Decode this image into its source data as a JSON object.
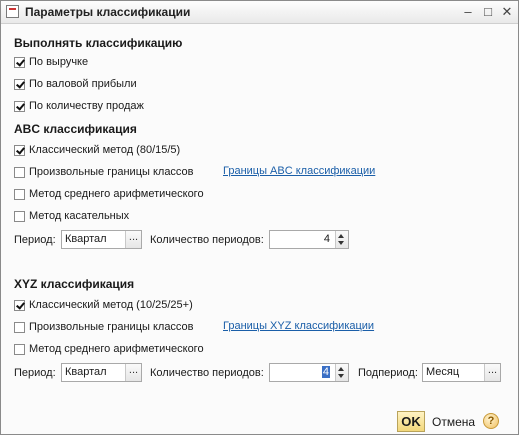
{
  "window": {
    "title": "Параметры классификации"
  },
  "classification": {
    "heading": "Выполнять классификацию",
    "options": [
      {
        "label": "По выручке",
        "checked": true
      },
      {
        "label": "По валовой прибыли",
        "checked": true
      },
      {
        "label": "По количеству продаж",
        "checked": true
      }
    ]
  },
  "abc": {
    "heading": "ABC классификация",
    "classic": {
      "label": "Классический метод (80/15/5)",
      "checked": true
    },
    "custom": {
      "label": "Произвольные границы классов",
      "checked": false
    },
    "link": "Границы ABC классификации",
    "mean": {
      "label": "Метод среднего арифметического",
      "checked": false
    },
    "tangent": {
      "label": "Метод касательных",
      "checked": false
    },
    "period_label": "Период:",
    "period_value": "Квартал",
    "count_label": "Количество периодов:",
    "count_value": "4"
  },
  "xyz": {
    "heading": "XYZ классификация",
    "classic": {
      "label": "Классический метод (10/25/25+)",
      "checked": true
    },
    "custom": {
      "label": "Произвольные границы классов",
      "checked": false
    },
    "link": "Границы XYZ классификации",
    "mean": {
      "label": "Метод среднего арифметического",
      "checked": false
    },
    "period_label": "Период:",
    "period_value": "Квартал",
    "count_label": "Количество периодов:",
    "count_value": "4",
    "subperiod_label": "Подпериод:",
    "subperiod_value": "Месяц"
  },
  "footer": {
    "ok": "OK",
    "cancel": "Отмена",
    "help": "?"
  },
  "ellipsis": "..."
}
